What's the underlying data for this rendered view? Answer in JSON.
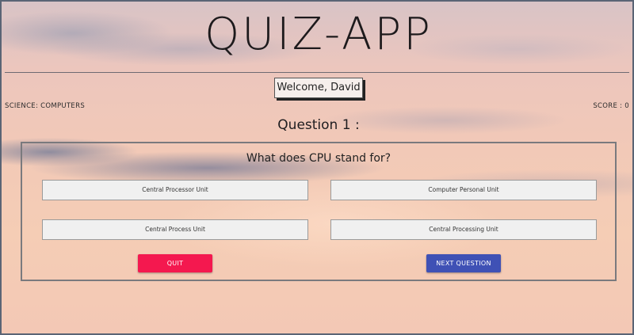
{
  "app": {
    "title": "QUIZ-APP"
  },
  "user": {
    "welcome": "Welcome, David"
  },
  "quiz": {
    "category": "SCIENCE: COMPUTERS",
    "score": "SCORE : 0",
    "question_number": "Question 1 :",
    "question_text": "What does CPU stand for?",
    "answers": [
      "Central Processor Unit",
      "Computer Personal Unit",
      "Central Process Unit",
      "Central Processing Unit"
    ]
  },
  "actions": {
    "quit_label": "QUIT",
    "next_label": "NEXT QUESTION"
  },
  "colors": {
    "quit": "#f4184f",
    "next": "#3f51b5",
    "accent_border": "#7a7a7e"
  }
}
